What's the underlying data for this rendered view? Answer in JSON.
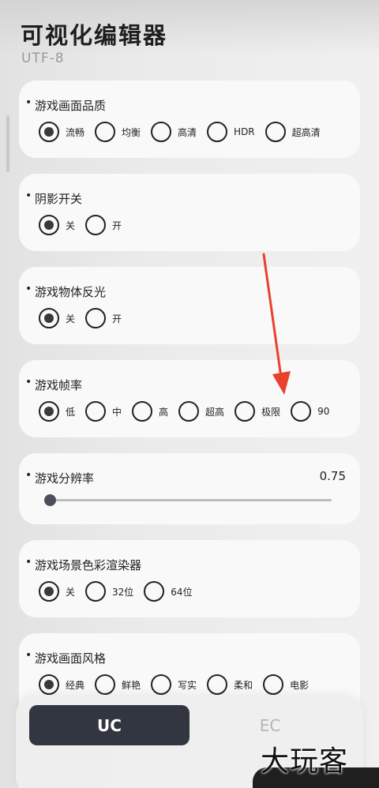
{
  "app": {
    "title": "可视化编辑器",
    "subtitle": "UTF-8"
  },
  "settings": [
    {
      "title": "游戏画面品质",
      "type": "radio",
      "options": [
        "流畅",
        "均衡",
        "高清",
        "HDR",
        "超高清"
      ],
      "selected": 0
    },
    {
      "title": "阴影开关",
      "type": "radio",
      "options": [
        "关",
        "开"
      ],
      "selected": 0
    },
    {
      "title": "游戏物体反光",
      "type": "radio",
      "options": [
        "关",
        "开"
      ],
      "selected": 0
    },
    {
      "title": "游戏帧率",
      "type": "radio",
      "options": [
        "低",
        "中",
        "高",
        "超高",
        "极限",
        "90"
      ],
      "selected": 0
    },
    {
      "title": "游戏分辨率",
      "type": "slider",
      "value": "0.75",
      "fill_fraction": 0
    },
    {
      "title": "游戏场景色彩渲染器",
      "type": "radio",
      "options": [
        "关",
        "32位",
        "64位"
      ],
      "selected": 0
    },
    {
      "title": "游戏画面风格",
      "type": "radio",
      "options": [
        "经典",
        "鲜艳",
        "写实",
        "柔和",
        "电影"
      ],
      "selected": 0
    }
  ],
  "bottom_tabs": {
    "uc": "UC",
    "ec": "EC"
  },
  "watermark": "大玩客",
  "colors": {
    "annotation_arrow": "#e8412c",
    "selected_tab": "#323641"
  }
}
